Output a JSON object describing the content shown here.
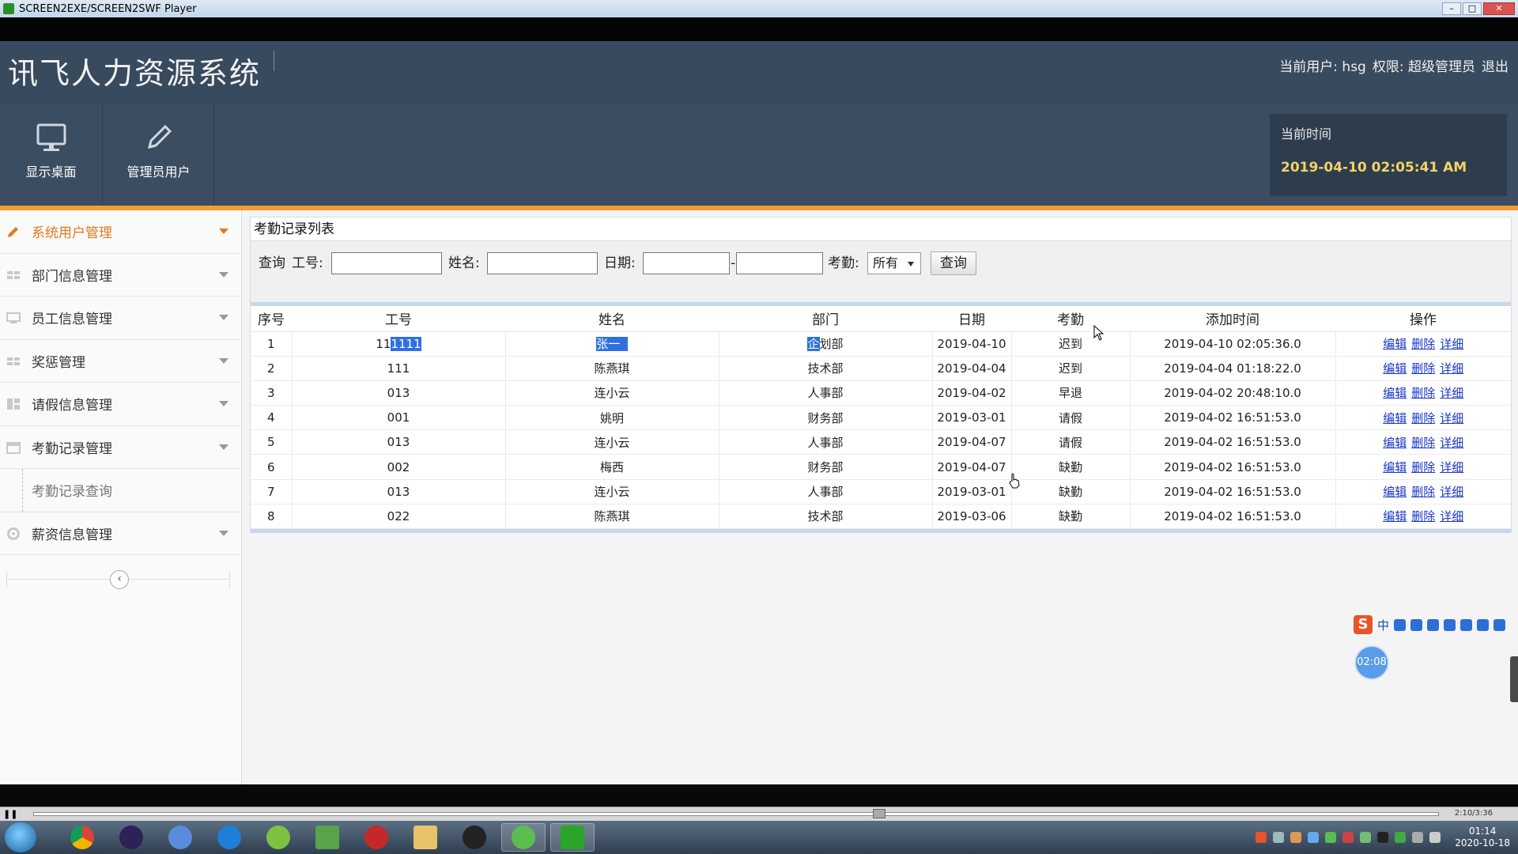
{
  "window": {
    "title": "SCREEN2EXE/SCREEN2SWF Player",
    "minimize": "–",
    "maximize": "□",
    "close": "✕"
  },
  "header": {
    "logo": "讯飞人力资源系统",
    "current_user_label": "当前用户:",
    "current_user": "hsg",
    "role_label": "权限:",
    "role": "超级管理员",
    "logout": "退出"
  },
  "toolbar": {
    "items": [
      {
        "label": "显示桌面",
        "icon": "monitor-icon"
      },
      {
        "label": "管理员用户",
        "icon": "pencil-icon"
      }
    ],
    "clock_label": "当前时间",
    "clock_value": "2019-04-10 02:05:41 AM"
  },
  "sidebar": {
    "items": [
      {
        "label": "系统用户管理",
        "icon": "pencil-icon",
        "active": true
      },
      {
        "label": "部门信息管理",
        "icon": "grid-icon"
      },
      {
        "label": "员工信息管理",
        "icon": "monitor-icon"
      },
      {
        "label": "奖惩管理",
        "icon": "grid-icon"
      },
      {
        "label": "请假信息管理",
        "icon": "columns-icon"
      },
      {
        "label": "考勤记录管理",
        "icon": "calendar-icon"
      }
    ],
    "sub_item": "考勤记录查询",
    "last_item": {
      "label": "薪资信息管理",
      "icon": "gear-icon"
    },
    "collapse": "‹"
  },
  "panel": {
    "title": "考勤记录列表",
    "search": {
      "query_label": "查询",
      "id_label": "工号:",
      "name_label": "姓名:",
      "date_label": "日期:",
      "date_sep": "-",
      "attendance_label": "考勤:",
      "attendance_value": "所有",
      "button": "查询"
    },
    "columns": [
      "序号",
      "工号",
      "姓名",
      "部门",
      "日期",
      "考勤",
      "添加时间",
      "操作"
    ],
    "rows": [
      {
        "no": "1",
        "id_a": "11",
        "id_b": "1111",
        "name": "张一",
        "dept_a": "企",
        "dept_b": "划部",
        "date": "2019-04-10",
        "status": "迟到",
        "added": "2019-04-10 02:05:36.0"
      },
      {
        "no": "2",
        "id": "111",
        "name": "陈燕琪",
        "dept": "技术部",
        "date": "2019-04-04",
        "status": "迟到",
        "added": "2019-04-04 01:18:22.0"
      },
      {
        "no": "3",
        "id": "013",
        "name": "连小云",
        "dept": "人事部",
        "date": "2019-04-02",
        "status": "早退",
        "added": "2019-04-02 20:48:10.0"
      },
      {
        "no": "4",
        "id": "001",
        "name": "姚明",
        "dept": "财务部",
        "date": "2019-03-01",
        "status": "请假",
        "added": "2019-04-02 16:51:53.0"
      },
      {
        "no": "5",
        "id": "013",
        "name": "连小云",
        "dept": "人事部",
        "date": "2019-04-07",
        "status": "请假",
        "added": "2019-04-02 16:51:53.0"
      },
      {
        "no": "6",
        "id": "002",
        "name": "梅西",
        "dept": "财务部",
        "date": "2019-04-07",
        "status": "缺勤",
        "added": "2019-04-02 16:51:53.0"
      },
      {
        "no": "7",
        "id": "013",
        "name": "连小云",
        "dept": "人事部",
        "date": "2019-03-01",
        "status": "缺勤",
        "added": "2019-04-02 16:51:53.0"
      },
      {
        "no": "8",
        "id": "022",
        "name": "陈燕琪",
        "dept": "技术部",
        "date": "2019-03-06",
        "status": "缺勤",
        "added": "2019-04-02 16:51:53.0"
      }
    ],
    "ops": {
      "edit": "编辑",
      "delete": "删除",
      "detail": "详细"
    }
  },
  "player": {
    "time": "2:10/3:36",
    "pause": "❚❚"
  },
  "overlay": {
    "ime_logo": "S",
    "ime_lang": "中",
    "timer": "02:08"
  },
  "taskbar": {
    "time": "01:14",
    "date": "2020-10-18"
  }
}
